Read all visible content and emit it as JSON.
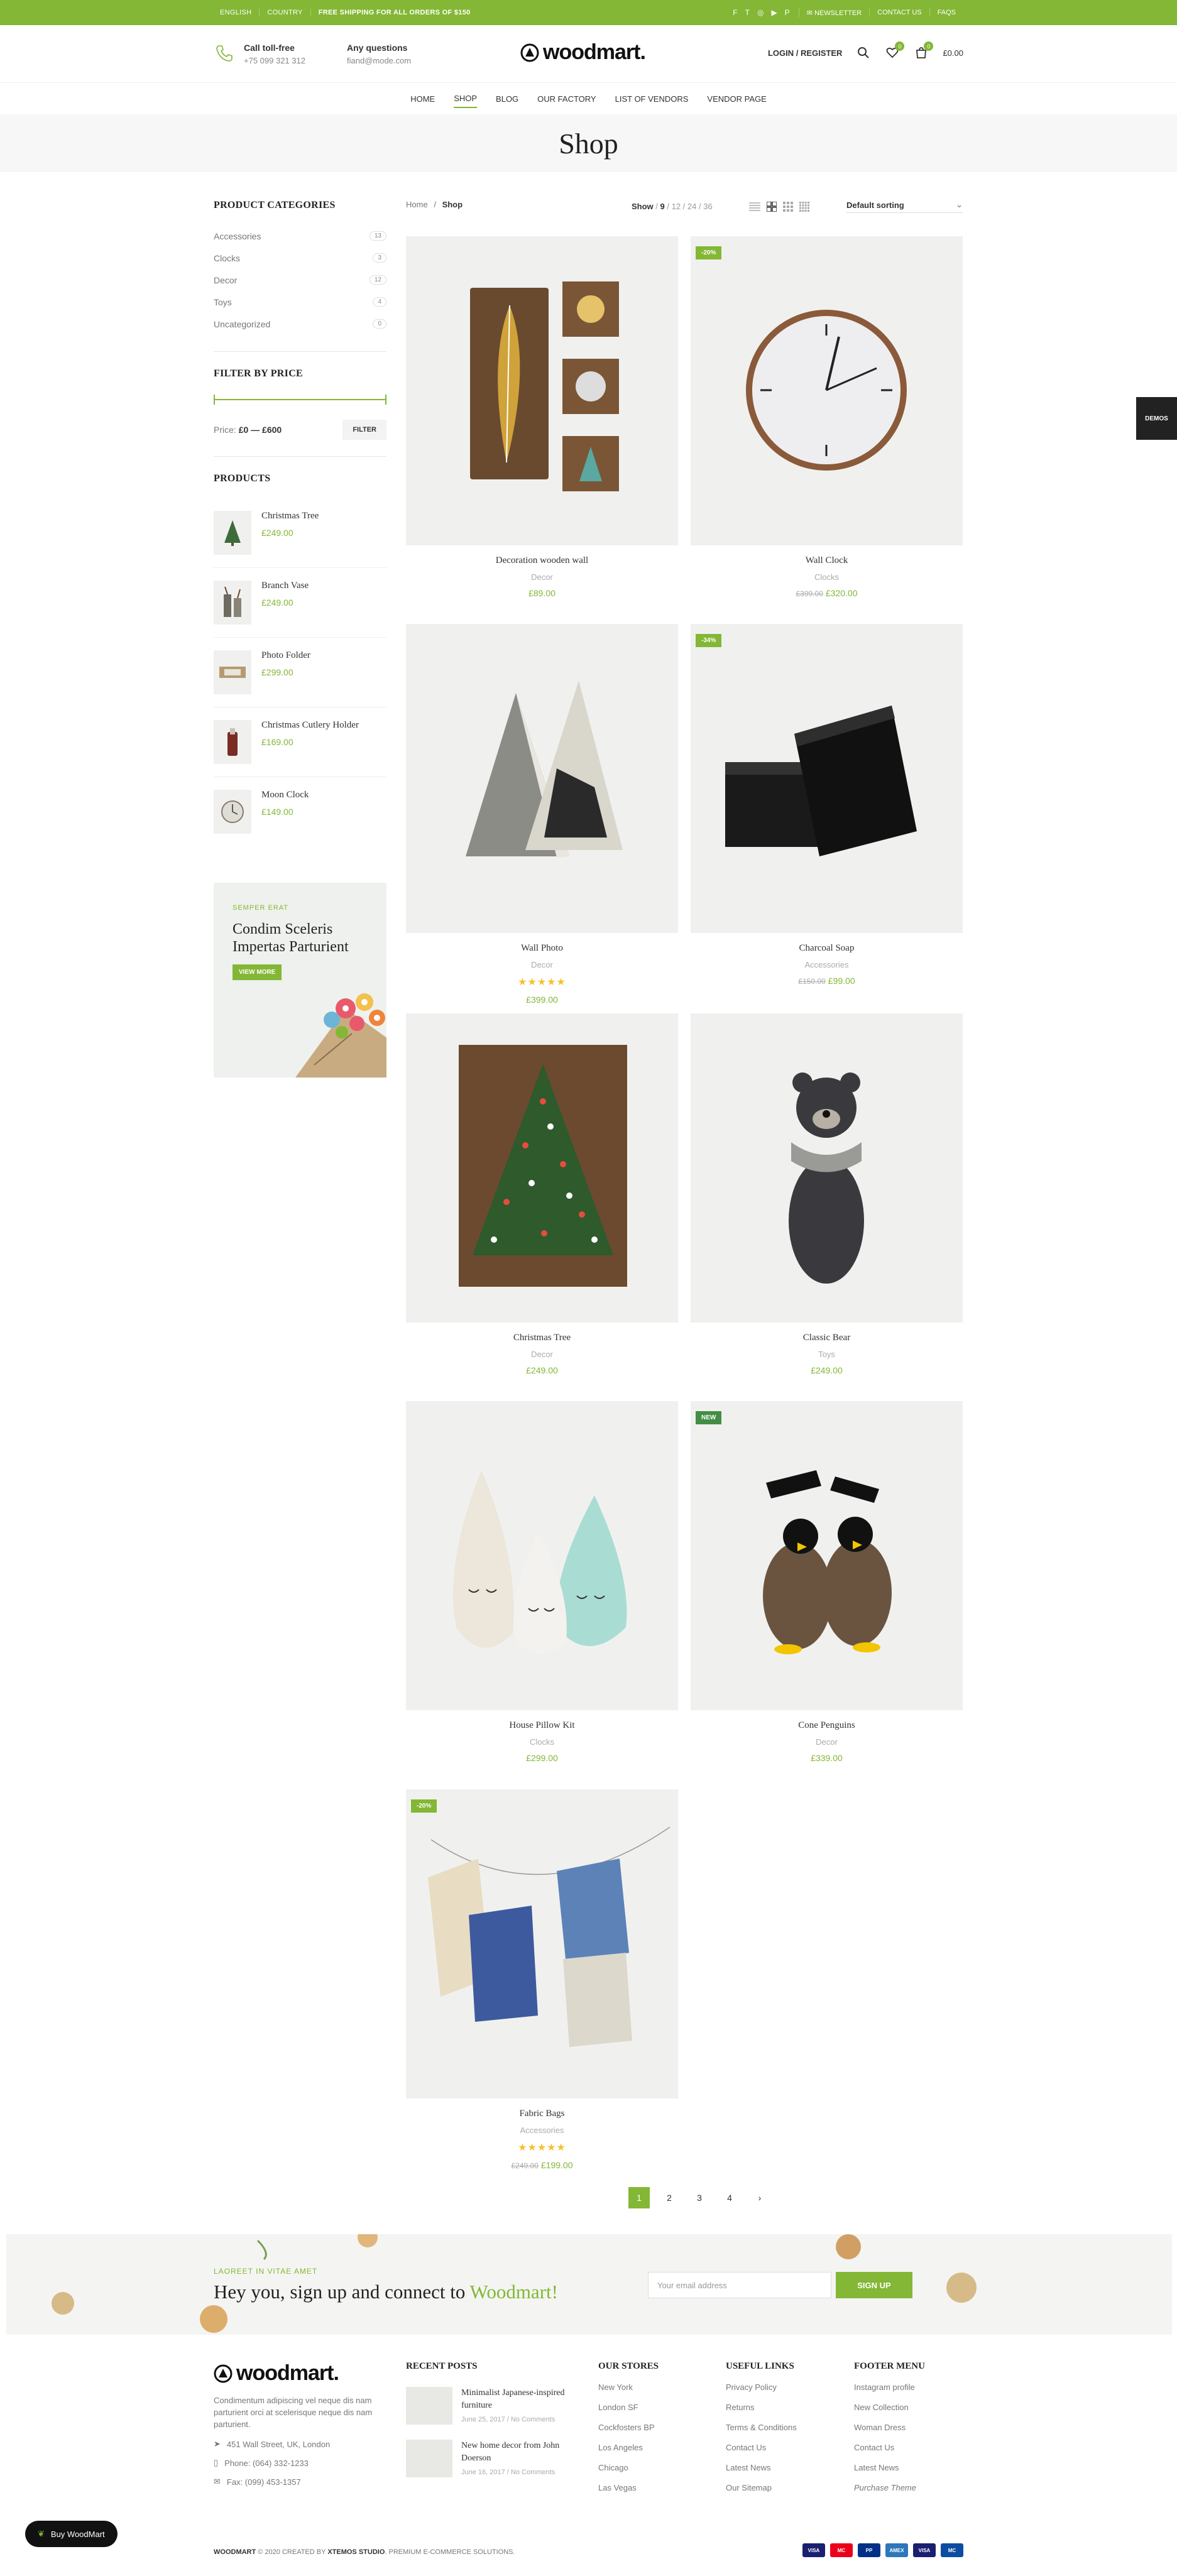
{
  "topbar": {
    "language": "English",
    "country": "Country",
    "shipping": "Free shipping for all orders of $150",
    "newsletter": "Newsletter",
    "contact": "Contact us",
    "faqs": "FAQs"
  },
  "header": {
    "call_title": "Call toll-free",
    "call_number": "+75 099 321 312",
    "question_title": "Any questions",
    "question_email": "fiand@mode.com",
    "logo": "woodmart.",
    "login": "Login / Register",
    "wishlist_count": "0",
    "cart_count": "0",
    "cart_total": "£0.00"
  },
  "nav": [
    "Home",
    "Shop",
    "Blog",
    "Our Factory",
    "List of Vendors",
    "Vendor Page"
  ],
  "page_title": "Shop",
  "breadcrumb": {
    "home": "Home",
    "sep": "/",
    "current": "Shop"
  },
  "toolbar": {
    "show_label": "Show",
    "show_options": [
      "9",
      "12",
      "24",
      "36"
    ],
    "sort": "Default sorting"
  },
  "sidebar": {
    "categories_title": "Product categories",
    "categories": [
      {
        "name": "Accessories",
        "count": "13"
      },
      {
        "name": "Clocks",
        "count": "3"
      },
      {
        "name": "Decor",
        "count": "12"
      },
      {
        "name": "Toys",
        "count": "4"
      },
      {
        "name": "Uncategorized",
        "count": "0"
      }
    ],
    "filter_title": "Filter by price",
    "price_label": "Price:",
    "price_range": "£0 — £600",
    "filter_button": "Filter",
    "products_title": "Products",
    "products": [
      {
        "name": "Christmas Tree",
        "price": "£249.00"
      },
      {
        "name": "Branch Vase",
        "price": "£249.00"
      },
      {
        "name": "Photo Folder",
        "price": "£299.00"
      },
      {
        "name": "Christmas Cutlery Holder",
        "price": "£169.00"
      },
      {
        "name": "Moon Clock",
        "price": "£149.00"
      }
    ],
    "promo": {
      "subtitle": "Semper Erat",
      "title": "Condim Sceleris Impertas Parturient",
      "button": "View More"
    }
  },
  "products": [
    {
      "name": "Decoration wooden wall",
      "category": "Decor",
      "price": "£89.00",
      "old_price": "",
      "label": "",
      "stars": ""
    },
    {
      "name": "Wall Clock",
      "category": "Clocks",
      "price": "£320.00",
      "old_price": "£399.00",
      "label": "-20%",
      "stars": ""
    },
    {
      "name": "Wall Photo",
      "category": "Decor",
      "price": "£399.00",
      "old_price": "",
      "label": "",
      "stars": "★★★★★"
    },
    {
      "name": "Charcoal Soap",
      "category": "Accessories",
      "price": "£99.00",
      "old_price": "£150.00",
      "label": "-34%",
      "stars": ""
    },
    {
      "name": "Christmas Tree",
      "category": "Decor",
      "price": "£249.00",
      "old_price": "",
      "label": "",
      "stars": ""
    },
    {
      "name": "Classic Bear",
      "category": "Toys",
      "price": "£249.00",
      "old_price": "",
      "label": "",
      "stars": ""
    },
    {
      "name": "House Pillow Kit",
      "category": "Clocks",
      "price": "£299.00",
      "old_price": "",
      "label": "",
      "stars": ""
    },
    {
      "name": "Cone Penguins",
      "category": "Decor",
      "price": "£339.00",
      "old_price": "",
      "label": "New",
      "stars": ""
    },
    {
      "name": "Fabric Bags",
      "category": "Accessories",
      "price": "£199.00",
      "old_price": "£249.00",
      "label": "-20%",
      "stars": "★★★★★"
    }
  ],
  "pagination": [
    "1",
    "2",
    "3",
    "4"
  ],
  "newsletter": {
    "subtitle": "Laoreet in vitae amet",
    "title": "Hey you, sign up and connect to",
    "title_accent": "Woodmart!",
    "placeholder": "Your email address",
    "button": "Sign up"
  },
  "footer": {
    "logo": "woodmart.",
    "description": "Condimentum adipiscing vel neque dis nam parturient orci at scelerisque neque dis nam parturient.",
    "address": "451 Wall Street, UK, London",
    "phone": "Phone: (064) 332-1233",
    "fax": "Fax: (099) 453-1357",
    "recent_posts_title": "Recent Posts",
    "recent_posts": [
      {
        "title": "Minimalist Japanese-inspired furniture",
        "date": "June 25, 2017",
        "comments": "No Comments"
      },
      {
        "title": "New home decor from John Doerson",
        "date": "June 16, 2017",
        "comments": "No Comments"
      }
    ],
    "stores_title": "Our Stores",
    "stores": [
      "New York",
      "London SF",
      "Cockfosters BP",
      "Los Angeles",
      "Chicago",
      "Las Vegas"
    ],
    "useful_title": "Useful Links",
    "useful": [
      "Privacy Policy",
      "Returns",
      "Terms & Conditions",
      "Contact Us",
      "Latest News",
      "Our Sitemap"
    ],
    "menu_title": "Footer Menu",
    "menu": [
      "Instagram profile",
      "New Collection",
      "Woman Dress",
      "Contact Us",
      "Latest News",
      "Purchase Theme"
    ],
    "copyright_brand": "Woodmart",
    "copyright_mid": "© 2020 Created by",
    "copyright_studio": "Xtemos Studio",
    "copyright_end": ". Premium e-commerce solutions.",
    "payments": [
      "VISA",
      "MC",
      "PP",
      "AMEX",
      "VISA",
      "MC"
    ]
  },
  "buy_button": "Buy WoodMart",
  "demos_button": "Demos",
  "colors": {
    "accent": "#83b735",
    "dark": "#222222"
  }
}
